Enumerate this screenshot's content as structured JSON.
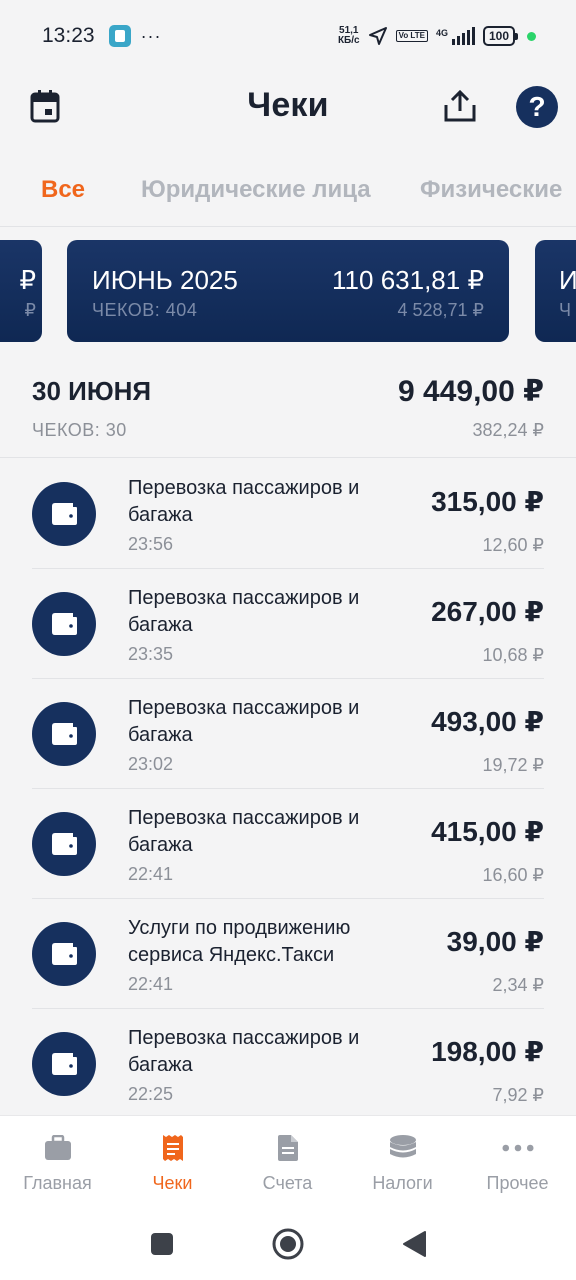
{
  "status_bar": {
    "time": "13:23",
    "dots": "···",
    "net_speed_value": "51,1",
    "net_speed_unit": "КБ/с",
    "volte": "Vo LTE",
    "net_type": "4G",
    "battery": "100"
  },
  "header": {
    "title": "Чеки"
  },
  "help_label": "?",
  "tabs": [
    {
      "label": "Все",
      "active": true
    },
    {
      "label": "Юридические лица",
      "active": false
    },
    {
      "label": "Физические",
      "active": false
    }
  ],
  "month_cards": {
    "prev": {
      "total_fragment": "₽",
      "tax_fragment": "₽"
    },
    "current": {
      "title": "ИЮНЬ 2025",
      "total": "110 631,81 ₽",
      "count": "ЧЕКОВ: 404",
      "tax": "4 528,71 ₽"
    },
    "next": {
      "title_fragment": "И",
      "count_fragment": "Ч"
    }
  },
  "day": {
    "title": "30 ИЮНЯ",
    "total": "9 449,00 ₽",
    "count": "ЧЕКОВ: 30",
    "tax": "382,24 ₽"
  },
  "receipts": [
    {
      "title": "Перевозка пассажиров и багажа",
      "time": "23:56",
      "amount": "315,00 ₽",
      "tax": "12,60 ₽"
    },
    {
      "title": "Перевозка пассажиров и багажа",
      "time": "23:35",
      "amount": "267,00 ₽",
      "tax": "10,68 ₽"
    },
    {
      "title": "Перевозка пассажиров и багажа",
      "time": "23:02",
      "amount": "493,00 ₽",
      "tax": "19,72 ₽"
    },
    {
      "title": "Перевозка пассажиров и багажа",
      "time": "22:41",
      "amount": "415,00 ₽",
      "tax": "16,60 ₽"
    },
    {
      "title": "Услуги по продвижению сервиса Яндекс.Такси",
      "time": "22:41",
      "amount": "39,00 ₽",
      "tax": "2,34 ₽"
    },
    {
      "title": "Перевозка пассажиров и багажа",
      "time": "22:25",
      "amount": "198,00 ₽",
      "tax": "7,92 ₽"
    }
  ],
  "bottom_nav": [
    {
      "label": "Главная",
      "icon": "briefcase-icon",
      "active": false
    },
    {
      "label": "Чеки",
      "icon": "receipt-icon",
      "active": true
    },
    {
      "label": "Счета",
      "icon": "document-icon",
      "active": false
    },
    {
      "label": "Налоги",
      "icon": "coins-icon",
      "active": false
    },
    {
      "label": "Прочее",
      "icon": "more-icon",
      "active": false
    }
  ],
  "colors": {
    "accent": "#f0661c",
    "navy": "#16305e",
    "muted": "#8c9098",
    "background": "#f4f4f5"
  }
}
